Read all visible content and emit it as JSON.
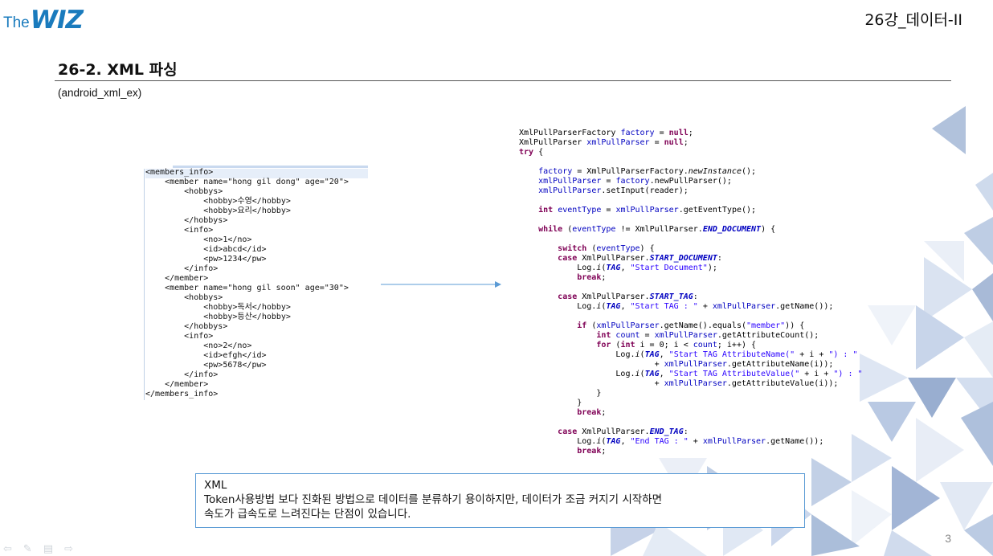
{
  "header": {
    "logo_the": "The",
    "logo_wiz": "WIZ",
    "chapter": "26강_데이터-II"
  },
  "section": {
    "title": "26-2. XML 파싱",
    "subtitle": "(android_xml_ex)"
  },
  "xml_lines": [
    "<members_info>",
    "    <member name=\"hong gil dong\" age=\"20\">",
    "        <hobbys>",
    "            <hobby>수영</hobby>",
    "            <hobby>요리</hobby>",
    "        </hobbys>",
    "        <info>",
    "            <no>1</no>",
    "            <id>abcd</id>",
    "            <pw>1234</pw>",
    "        </info>",
    "    </member>",
    "    <member name=\"hong gil soon\" age=\"30\">",
    "        <hobbys>",
    "            <hobby>독서</hobby>",
    "            <hobby>등산</hobby>",
    "        </hobbys>",
    "        <info>",
    "            <no>2</no>",
    "            <id>efgh</id>",
    "            <pw>5678</pw>",
    "        </info>",
    "    </member>",
    "</members_info>"
  ],
  "code_lines": [
    "XmlPullParserFactory factory = null;",
    "XmlPullParser xmlPullParser = null;",
    "try {",
    "",
    "    factory = XmlPullParserFactory.newInstance();",
    "    xmlPullParser = factory.newPullParser();",
    "    xmlPullParser.setInput(reader);",
    "",
    "    int eventType = xmlPullParser.getEventType();",
    "",
    "    while (eventType != XmlPullParser.END_DOCUMENT) {",
    "",
    "        switch (eventType) {",
    "        case XmlPullParser.START_DOCUMENT:",
    "            Log.i(TAG, \"Start Document\");",
    "            break;",
    "",
    "        case XmlPullParser.START_TAG:",
    "            Log.i(TAG, \"Start TAG : \" + xmlPullParser.getName());",
    "",
    "            if (xmlPullParser.getName().equals(\"member\")) {",
    "                int count = xmlPullParser.getAttributeCount();",
    "                for (int i = 0; i < count; i++) {",
    "                    Log.i(TAG, \"Start TAG AttributeName(\" + i + \") : \"",
    "                            + xmlPullParser.getAttributeName(i));",
    "                    Log.i(TAG, \"Start TAG AttributeValue(\" + i + \") : \"",
    "                            + xmlPullParser.getAttributeValue(i));",
    "                }",
    "            }",
    "            break;",
    "",
    "        case XmlPullParser.END_TAG:",
    "            Log.i(TAG, \"End TAG : \" + xmlPullParser.getName());",
    "            break;"
  ],
  "note": {
    "line1": "XML",
    "line2": "Token사용방법 보다 진화된 방법으로 데이터를 분류하기 용이하지만, 데이터가 조금 커지기 시작하면",
    "line3": "속도가 급속도로 느려진다는 단점이 있습니다."
  },
  "page_number": "3",
  "colors": {
    "brand": "#1a7bbd",
    "note_border": "#5b9bd5",
    "keyword": "#7f0055",
    "field": "#0000c0",
    "string": "#2a00ff"
  }
}
